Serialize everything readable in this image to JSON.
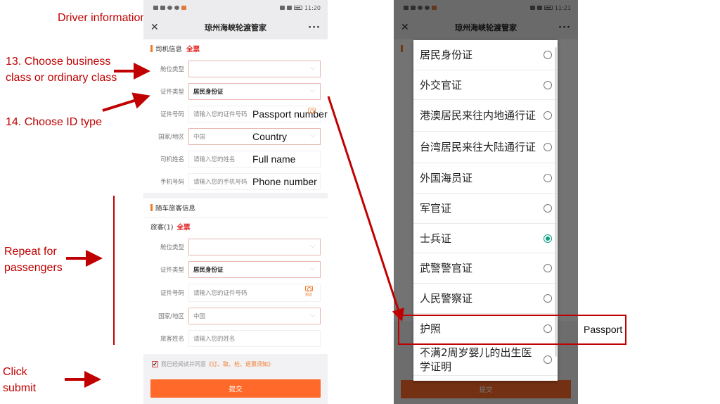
{
  "annotations": {
    "driver_info": "Driver information",
    "step13": "13. Choose business class or ordinary class",
    "step14": "14. Choose ID type",
    "repeat": "Repeat for passengers",
    "click_submit": "Click submit",
    "passport_number": "Passport number",
    "country": "Country",
    "full_name": "Full name",
    "phone_number": "Phone number",
    "passport": "Passport"
  },
  "left_phone": {
    "status": {
      "time": "11:20"
    },
    "nav": {
      "close_icon": "close-icon",
      "title": "琼州海峡轮渡管家",
      "more": "···"
    },
    "driver_section": {
      "title": "司机信息",
      "tag": "全票",
      "fields": [
        {
          "label": "舱位类型",
          "value": "",
          "type": "select"
        },
        {
          "label": "证件类型",
          "value": "居民身份证",
          "type": "select"
        },
        {
          "label": "证件号码",
          "placeholder": "请输入您的证件号码",
          "type": "input"
        },
        {
          "label": "国家/地区",
          "value": "中国",
          "type": "select"
        },
        {
          "label": "司机姓名",
          "placeholder": "请输入您的姓名",
          "type": "input"
        },
        {
          "label": "手机号码",
          "placeholder": "请输入您的手机号码",
          "type": "input"
        }
      ]
    },
    "passenger_section": {
      "title": "随车旅客信息",
      "passenger_label": "旅客(1)",
      "tag": "全票",
      "fields": [
        {
          "label": "舱位类型",
          "value": "",
          "type": "select"
        },
        {
          "label": "证件类型",
          "value": "居民身份证",
          "type": "select"
        },
        {
          "label": "证件号码",
          "placeholder": "请输入您的证件号码",
          "type": "input",
          "camera_label": "拍证"
        },
        {
          "label": "国家/地区",
          "value": "中国",
          "type": "select"
        },
        {
          "label": "旅客姓名",
          "placeholder": "请输入您的姓名",
          "type": "input"
        }
      ]
    },
    "agree": {
      "checked": true,
      "text": "我已经阅读并同意",
      "link": "《订、取、检、退票须知》"
    },
    "submit_label": "提交"
  },
  "right_phone": {
    "status": {
      "time": "11:21"
    },
    "nav": {
      "title": "琼州海峡轮渡管家",
      "more": "···"
    },
    "submit_label": "提交",
    "id_options": [
      {
        "label": "居民身份证",
        "selected": false
      },
      {
        "label": "外交官证",
        "selected": false
      },
      {
        "label": "港澳居民来往内地通行证",
        "selected": false
      },
      {
        "label": "台湾居民来往大陆通行证",
        "selected": false
      },
      {
        "label": "外国海员证",
        "selected": false
      },
      {
        "label": "军官证",
        "selected": false
      },
      {
        "label": "士兵证",
        "selected": true
      },
      {
        "label": "武警警官证",
        "selected": false
      },
      {
        "label": "人民警察证",
        "selected": false
      },
      {
        "label": "护照",
        "selected": false
      },
      {
        "label": "不满2周岁婴儿的出生医学证明",
        "selected": false
      }
    ]
  },
  "colors": {
    "accent_orange": "#ff6a2a",
    "annotation_red": "#c00000",
    "radio_selected": "#0f9d82",
    "tag_red": "#e02020"
  }
}
